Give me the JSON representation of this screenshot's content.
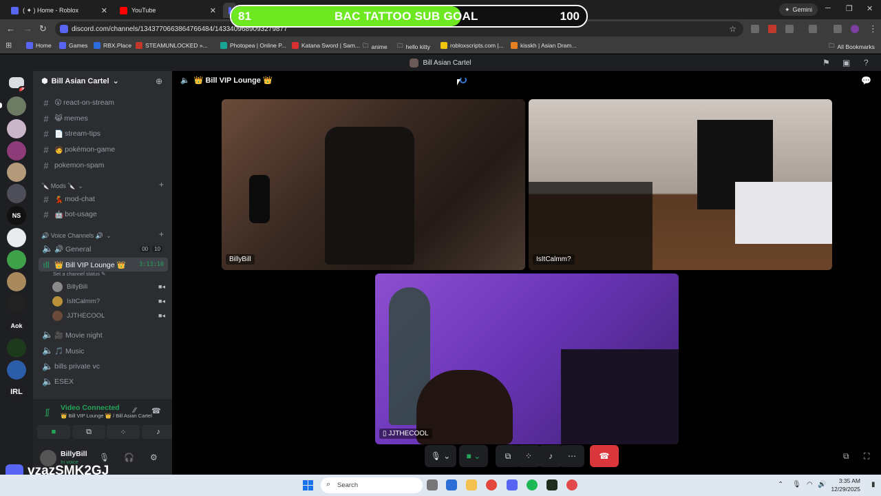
{
  "browser": {
    "tabs": [
      {
        "title": "( ✦ ) Home - Roblox",
        "active": false
      },
      {
        "title": "YouTube",
        "active": false
      },
      {
        "title": "",
        "active": true
      }
    ],
    "gemini_label": "Gemini",
    "url": "discord.com/channels/1343770663864766484/1433409689093279877",
    "bookmarks": [
      "Home",
      "Games",
      "RBX.Place",
      "STEAMUNLOCKED »...",
      "Photopea | Online P...",
      "Katana Sword | Sam...",
      "anime",
      "hello kitty",
      "robloxscripts.com |...",
      "kisskh | Asian Dram..."
    ],
    "all_bookmarks": "All Bookmarks"
  },
  "sub_goal": {
    "current": 81,
    "title": "BAC TATTOO SUB GOAL",
    "goal": 100,
    "fill_fraction": 0.81,
    "fill_color": "#6ee820"
  },
  "discord": {
    "window_title": "Bill Asian Cartel",
    "guild_name": "Bill Asian Cartel",
    "rail": {
      "dm_badge": "3",
      "labels": [
        "NS",
        "Aok",
        "IRL"
      ]
    },
    "channels": [
      {
        "emoji": "😮",
        "name": "react-on-stream"
      },
      {
        "emoji": "😹",
        "name": "memes"
      },
      {
        "emoji": "📄",
        "name": "stream-tips"
      },
      {
        "emoji": "🧑",
        "name": "pokémon-game"
      },
      {
        "emoji": "",
        "name": "pokemon-spam"
      }
    ],
    "mods_category": "🔪 Mods 🔪",
    "mod_channels": [
      {
        "emoji": "💃",
        "name": "mod-chat"
      },
      {
        "emoji": "🤖",
        "name": "bot-usage"
      }
    ],
    "voice_category": "🔊 Voice Channels 🔊",
    "voice_channels": {
      "general": {
        "name": "🔊 General",
        "meta_a": "00",
        "meta_b": "10"
      },
      "vip": {
        "name": "👑 Bill VIP Lounge 👑",
        "timer": "3:13:10",
        "status_hint": "Set a channel status"
      },
      "users": [
        "BillyBill",
        "IsItCalmm?",
        "JJTHECOOL"
      ],
      "others": [
        "🎥 Movie night",
        "🎵 Music",
        "bills private vc",
        "ESEX"
      ]
    },
    "voice_panel": {
      "title": "Video Connected",
      "subtitle": "👑 Bill VIP Lounge 👑 / Bill Asian Cartel"
    },
    "user": {
      "name": "BillyBill",
      "status": "In voice"
    },
    "main_header": "👑 Bill VIP Lounge 👑",
    "tiles": [
      {
        "name": "BillyBill"
      },
      {
        "name": "IsItCalmm?"
      },
      {
        "name": "JJTHECOOL"
      }
    ]
  },
  "watermark": "vzazSMK2GJ",
  "taskbar": {
    "search_placeholder": "Search",
    "time": "3:35 AM",
    "date": "12/29/2025"
  }
}
